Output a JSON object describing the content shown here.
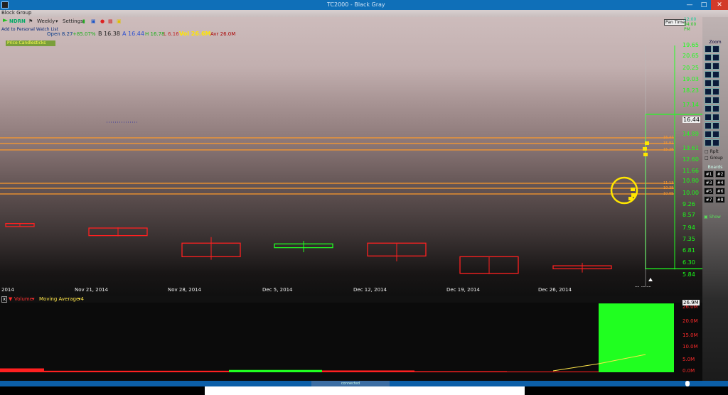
{
  "window": {
    "title": "TC2000 - Black Gray",
    "menu_label": "Block Group"
  },
  "toolbar": {
    "symbol": "NDRN",
    "timeframe": "Weekly",
    "settings_label": "Settings",
    "watchlist_label": "Add to Personal Watch List",
    "zoom_badge": "Pan Time",
    "clock_top": "12:00",
    "clock_bottom": "04:00 PM"
  },
  "quote": {
    "open": "Open 8.27",
    "change": "+85.07%",
    "bid": "B 16.38",
    "ask": "A 16.44",
    "high": "H 16.78",
    "low": "L 6.16",
    "volume": "Vol 26.6M",
    "avg": "Avr 26.0M"
  },
  "indicator_tag": "Price Candlesticks",
  "price_axis": {
    "labels": [
      "19.65",
      "20.65",
      "20.25",
      "19.03",
      "18.23",
      "17.14",
      "16.44",
      "14.89",
      "13.61",
      "12.60",
      "11.66",
      "10.80",
      "10.00",
      "9.26",
      "8.57",
      "7.94",
      "7.35",
      "6.81",
      "6.30",
      "5.84"
    ],
    "current": "16.44",
    "last_label": "5.84"
  },
  "horizontal_levels": {
    "upper": [
      "16.47",
      "15.81",
      "15.28"
    ],
    "lower": [
      "11.13",
      "10.38",
      "10.05"
    ]
  },
  "dates": [
    "2014",
    "Nov 21, 2014",
    "Nov 28, 2014",
    "Dec 5, 2014",
    "Dec 12, 2014",
    "Dec 19, 2014",
    "Dec 26, 2014"
  ],
  "last_time": "02:46:20",
  "volume_header": {
    "close_x": "x",
    "volume_label": "Volume",
    "ma_label": "Moving Average 4"
  },
  "volume_axis": [
    "26.0M",
    "20.0M",
    "15.0M",
    "10.0M",
    "5.0M",
    "0.0M"
  ],
  "volume_current": "26.9M",
  "toolbox": {
    "header": "Zoom",
    "boards_header": "Boards",
    "boards": [
      "#1",
      "#2",
      "#3",
      "#4",
      "#5",
      "#6",
      "#7",
      "#8"
    ],
    "checkbox_1": "Rplt",
    "checkbox_2": "Group",
    "show_label": "Show"
  },
  "status_center": "connected",
  "colors": {
    "up": "#20ff20",
    "down": "#ff2020",
    "level": "#ff9a2a",
    "accent": "#0f6fb8",
    "highlight": "#ffe600"
  },
  "chart_data": {
    "type": "candlestick",
    "candles": [
      {
        "date": "2014",
        "open": 9.2,
        "close": 9.0,
        "high": 9.2,
        "low": 9.0,
        "dir": "down"
      },
      {
        "date": "Nov 21, 2014",
        "open": 8.9,
        "close": 8.4,
        "high": 8.95,
        "low": 8.35,
        "dir": "down"
      },
      {
        "date": "Nov 28, 2014",
        "open": 7.9,
        "close": 7.0,
        "high": 8.3,
        "low": 6.8,
        "dir": "down"
      },
      {
        "date": "Dec 5, 2014",
        "open": 7.6,
        "close": 7.85,
        "high": 8.05,
        "low": 7.3,
        "dir": "up"
      },
      {
        "date": "Dec 12, 2014",
        "open": 7.9,
        "close": 7.05,
        "high": 7.9,
        "low": 6.7,
        "dir": "down"
      },
      {
        "date": "Dec 19, 2014",
        "open": 7.0,
        "close": 5.9,
        "high": 7.0,
        "low": 5.85,
        "dir": "down"
      },
      {
        "date": "Dec 26, 2014",
        "open": 6.4,
        "close": 6.2,
        "high": 6.6,
        "low": 5.95,
        "dir": "down"
      },
      {
        "date": "Jan 2, 2015",
        "open": 6.2,
        "close": 16.44,
        "high": 21.0,
        "low": 6.16,
        "dir": "up"
      }
    ],
    "volume": [
      1.5,
      0.6,
      0.6,
      0.9,
      0.7,
      0.4,
      0.3,
      26.6
    ],
    "ylim": [
      5.84,
      21.0
    ],
    "vol_ylim": [
      0,
      26.9
    ]
  }
}
